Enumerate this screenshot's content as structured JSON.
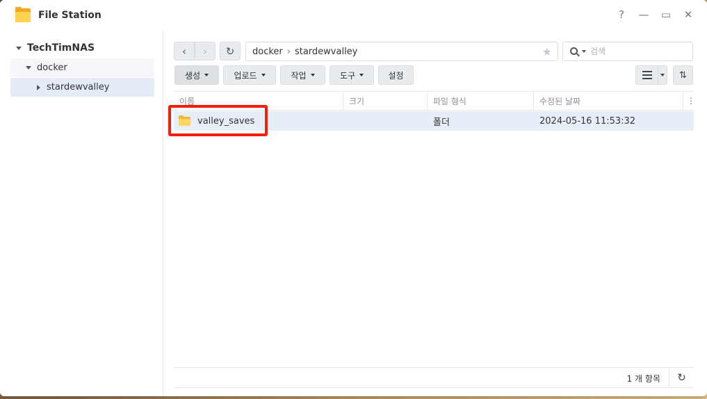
{
  "window": {
    "title": "File Station",
    "app_icon": "file-station-folder-icon"
  },
  "window_controls": [
    {
      "name": "help-button",
      "glyph": "?"
    },
    {
      "name": "minimize-button",
      "glyph": "—"
    },
    {
      "name": "maximize-button",
      "glyph": "▭"
    },
    {
      "name": "close-button",
      "glyph": "✕"
    }
  ],
  "sidebar": {
    "root": "TechTimNAS",
    "docker": "docker",
    "stardewvalley": "stardewvalley"
  },
  "nav": {
    "back_glyph": "‹",
    "forward_glyph": "›",
    "refresh_glyph": "↻",
    "path_segments": [
      "docker",
      "stardewvalley"
    ],
    "path_separator": "›",
    "star_glyph": "★",
    "search_placeholder": "검색"
  },
  "toolbar": {
    "create_label": "생성",
    "upload_label": "업로드",
    "action_label": "작업",
    "tools_label": "도구",
    "settings_label": "설정",
    "sort_glyph": "⇅"
  },
  "table": {
    "columns": [
      "이름",
      "크기",
      "파일 형식",
      "수정된 날짜"
    ],
    "more_glyph": "⋮",
    "rows": [
      {
        "name": "valley_saves",
        "size": "",
        "type": "폴더",
        "modified": "2024-05-16 11:53:32",
        "icon": "folder-icon",
        "selected": true
      }
    ]
  },
  "status": {
    "count_label": "1 개 항목",
    "refresh_glyph": "↻"
  },
  "colors": {
    "highlight": "#f21f0b",
    "selected_row": "#e7eef8",
    "folder": "#ffd460"
  }
}
